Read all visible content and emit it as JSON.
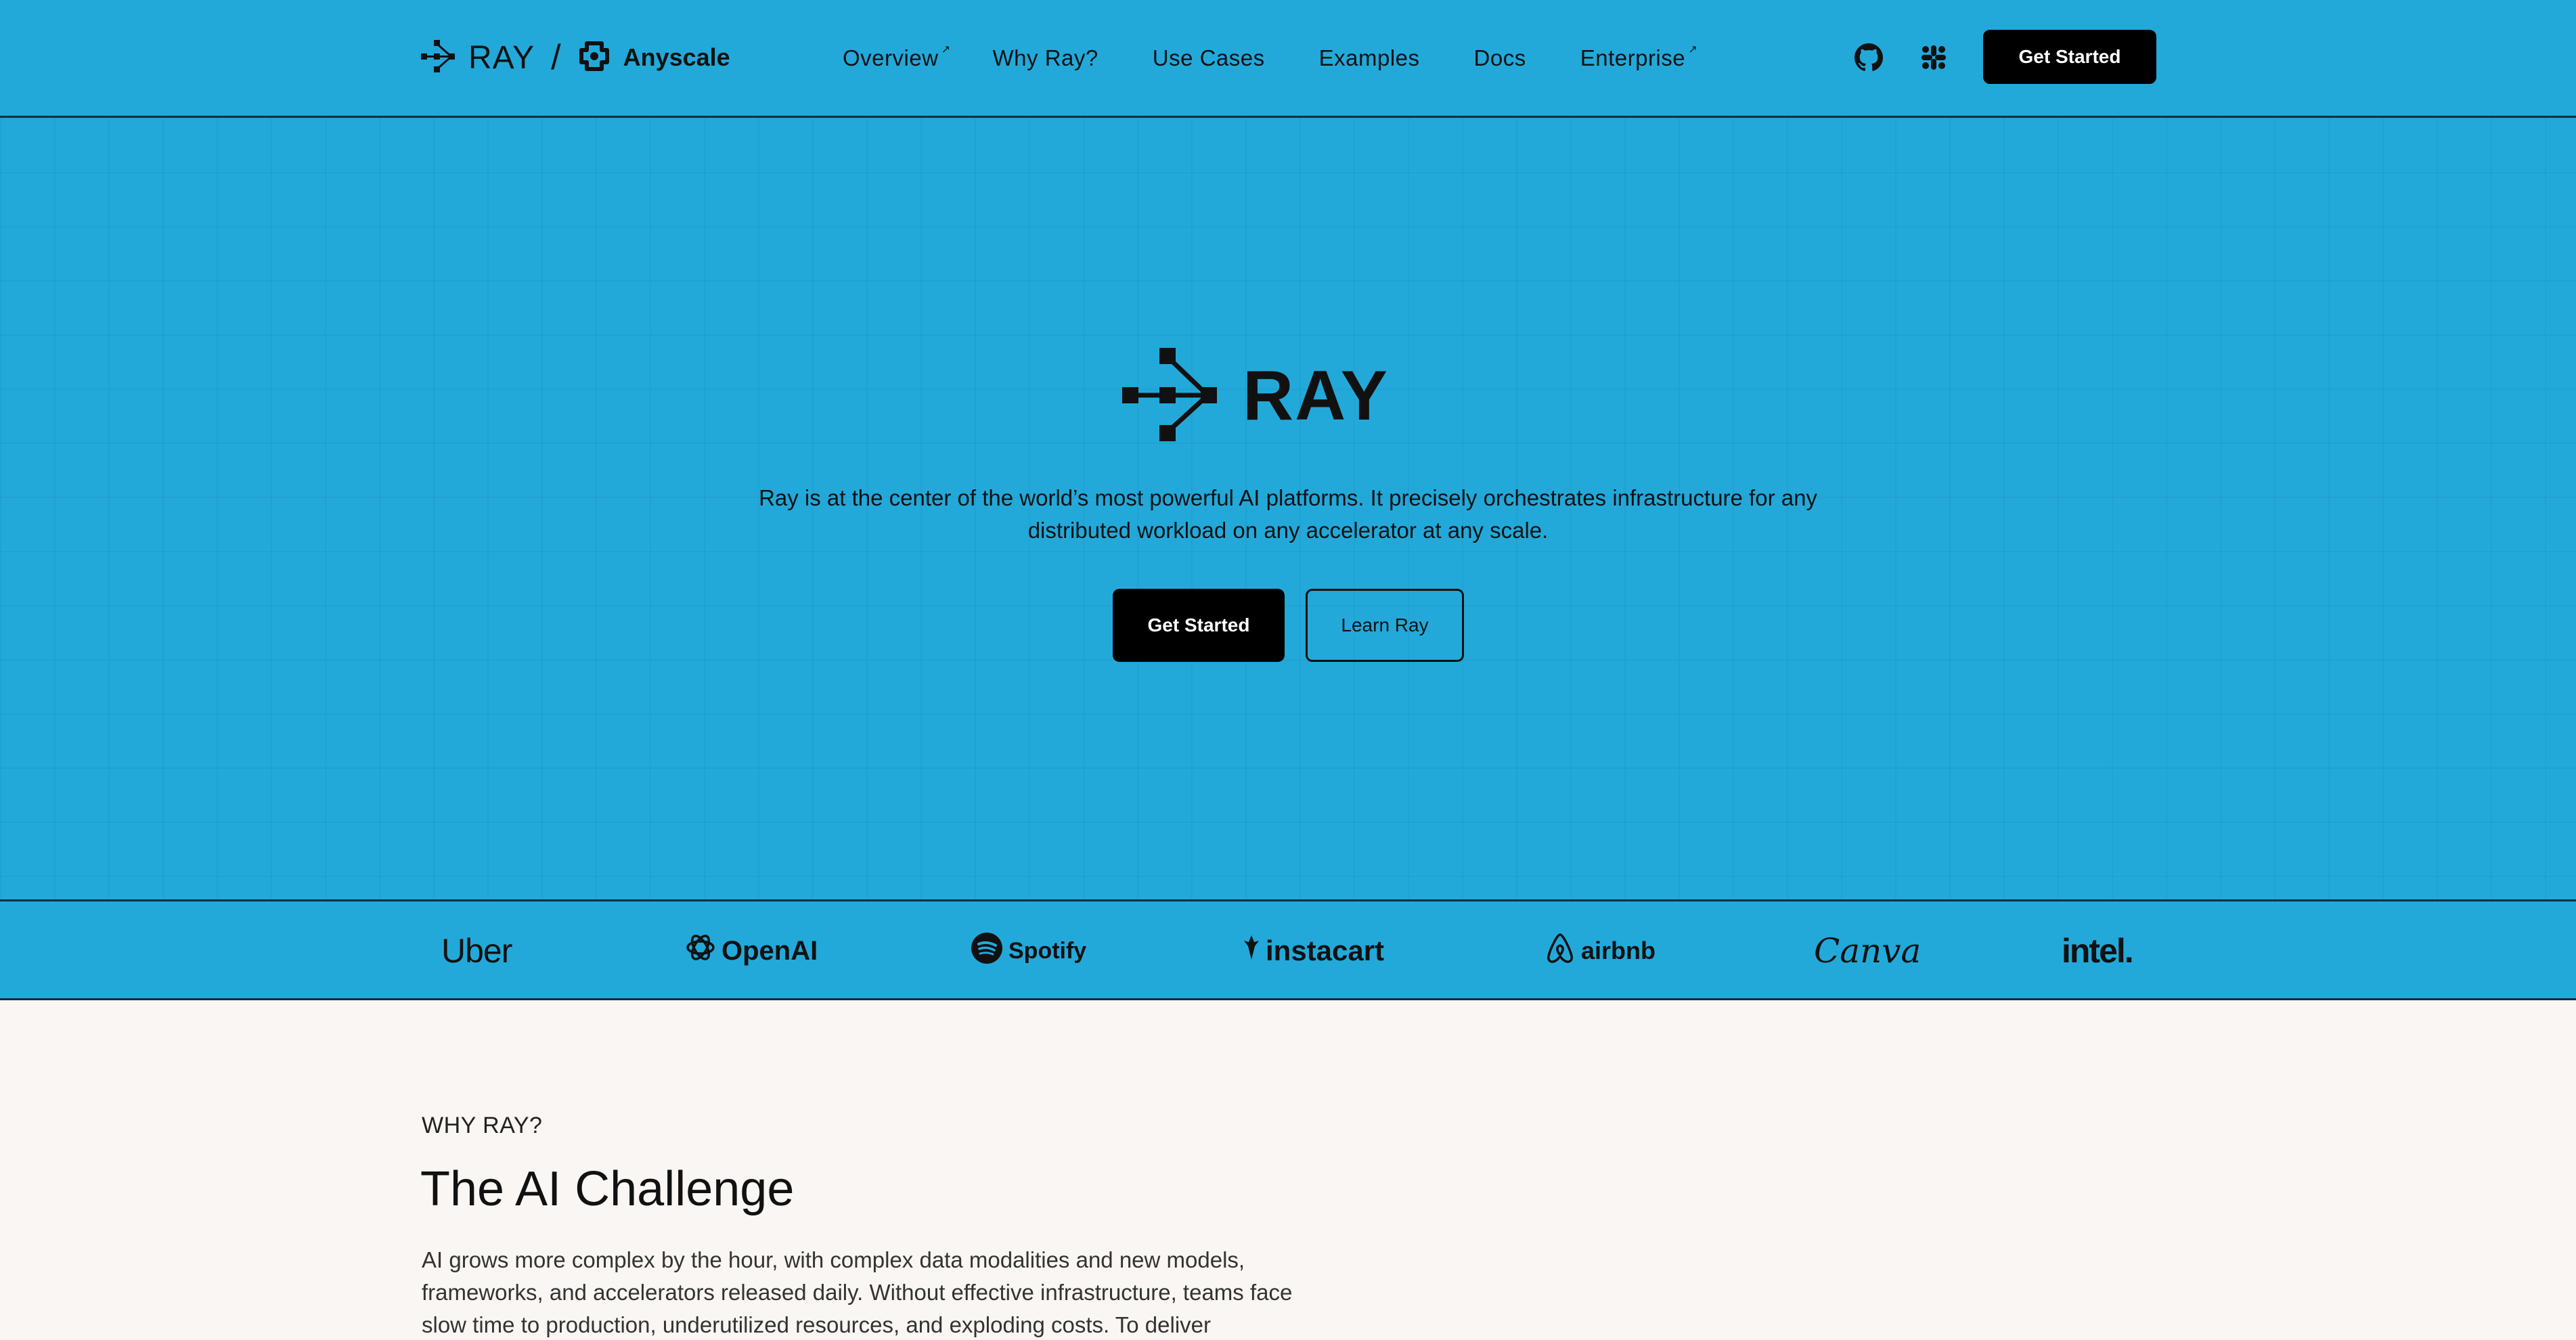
{
  "nav": {
    "brand": {
      "ray": "RAY",
      "separator": "/",
      "anyscale": "Anyscale"
    },
    "links": [
      {
        "label": "Overview",
        "external": true
      },
      {
        "label": "Why Ray?",
        "external": false
      },
      {
        "label": "Use Cases",
        "external": false
      },
      {
        "label": "Examples",
        "external": false
      },
      {
        "label": "Docs",
        "external": false
      },
      {
        "label": "Enterprise",
        "external": true
      }
    ],
    "icons": [
      "github-icon",
      "slack-icon"
    ],
    "cta": "Get Started"
  },
  "hero": {
    "logo_word": "RAY",
    "description": "Ray is at the center of the world’s most powerful AI platforms. It precisely orchestrates infrastructure for any distributed workload on any accelerator at any scale.",
    "primary_button": "Get Started",
    "secondary_button": "Learn Ray"
  },
  "customers": [
    "Uber",
    "OpenAI",
    "Spotify",
    "instacart",
    "airbnb",
    "Canva",
    "intel."
  ],
  "why": {
    "eyebrow": "WHY RAY?",
    "title": "The AI Challenge",
    "body": "AI grows more complex by the hour, with complex data modalities and new models, frameworks, and accelerators released daily. Without effective infrastructure, teams face slow time to production, underutilized resources, and exploding costs. To deliver"
  },
  "colors": {
    "hero_blue": "#22a9da",
    "page_bg": "#faf6f4",
    "ink": "#111111"
  }
}
